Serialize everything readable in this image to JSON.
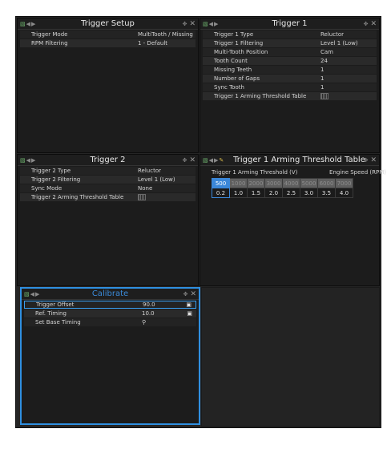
{
  "panels": {
    "trigger_setup": {
      "title": "Trigger Setup",
      "rows": [
        {
          "label": "Trigger Mode",
          "value": "MultiTooth / Missing"
        },
        {
          "label": "RPM Filtering",
          "value": "1 - Default"
        }
      ]
    },
    "trigger1": {
      "title": "Trigger 1",
      "rows": [
        {
          "label": "Trigger 1 Type",
          "value": "Reluctor"
        },
        {
          "label": "Trigger 1 Filtering",
          "value": "Level 1 (Low)"
        },
        {
          "label": "Multi-Tooth Position",
          "value": "Cam"
        },
        {
          "label": "Tooth Count",
          "value": "24"
        },
        {
          "label": "Missing Teeth",
          "value": "1"
        },
        {
          "label": "Number of Gaps",
          "value": "1"
        },
        {
          "label": "Sync Tooth",
          "value": "1"
        },
        {
          "label": "Trigger 1 Arming Threshold Table",
          "value": ""
        }
      ]
    },
    "trigger2": {
      "title": "Trigger 2",
      "rows": [
        {
          "label": "Trigger 2 Type",
          "value": "Reluctor"
        },
        {
          "label": "Trigger 2 Filtering",
          "value": "Level 1 (Low)"
        },
        {
          "label": "Sync Mode",
          "value": "None"
        },
        {
          "label": "Trigger 2 Arming Threshold Table",
          "value": ""
        }
      ]
    },
    "threshold_table": {
      "title": "Trigger 1 Arming Threshold Table",
      "y_label": "Trigger 1 Arming Threshold (V)",
      "x_label": "Engine Speed (RPM)",
      "rpm": [
        "500",
        "1000",
        "2000",
        "3000",
        "4000",
        "5000",
        "6000",
        "7000"
      ],
      "thresholds": [
        "0.2",
        "1.0",
        "1.5",
        "2.0",
        "2.5",
        "3.0",
        "3.5",
        "4.0"
      ]
    },
    "calibrate": {
      "title": "Calibrate",
      "rows": [
        {
          "label": "Trigger Offset",
          "value": "90.0"
        },
        {
          "label": "Ref. Timing",
          "value": "10.0"
        },
        {
          "label": "Set Base Timing",
          "value": ""
        }
      ]
    }
  },
  "icons": {
    "lock": "lock-icon",
    "move": "move-icon",
    "close": "close-icon",
    "nav": "nav-arrows-icon",
    "tune": "tune-icon",
    "table": "table-icon",
    "wrench": "wrench-icon"
  },
  "colors": {
    "accent": "#3b87d8",
    "panel_bg": "#1c1c1c",
    "row_bg": "#232323",
    "row_alt_bg": "#2a2a2a",
    "axis_bg": "#5f5f5f"
  }
}
